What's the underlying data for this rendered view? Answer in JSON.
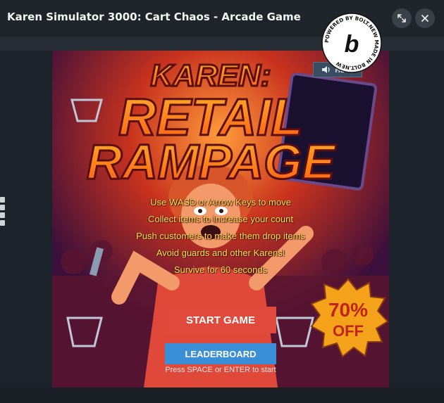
{
  "window": {
    "title": "Karen Simulator 3000: Cart Chaos - Arcade Game",
    "expand_icon": "expand-arrows-icon",
    "close_icon": "close-icon"
  },
  "game": {
    "title_line1": "KAREN:",
    "title_line2": "RETAIL",
    "title_line3": "RAMPAGE",
    "mute_label": "Mute",
    "sale_badge_percent": "70%",
    "sale_badge_text": "OFF",
    "instructions": [
      "Use WASD or Arrow Keys to move",
      "Collect items to increase your count",
      "Push customers to make them drop items",
      "Avoid guards and other Karens!",
      "Survive for 60 seconds"
    ],
    "start_label": "START GAME",
    "leaderboard_label": "LEADERBOARD",
    "hint": "Press SPACE or ENTER to start"
  },
  "bolt_badge": {
    "text": "POWERED BY BOLT.NEW MADE IN BOLT.NEW",
    "letter": "b"
  },
  "colors": {
    "start_button": "#e04a3c",
    "leaderboard_button": "#3a8fd6",
    "instruction_text": "#ffe34a",
    "title_fill": "#ff7a1a"
  }
}
